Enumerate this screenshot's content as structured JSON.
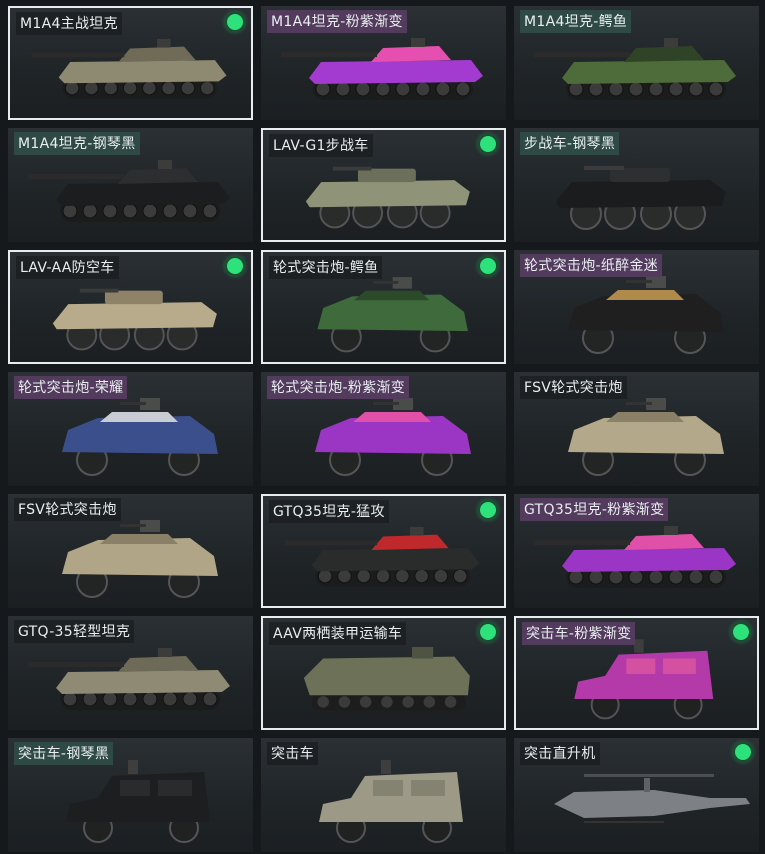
{
  "vehicles": [
    {
      "label": "M1A4主战坦克",
      "tag": "plain",
      "selected": true,
      "owned": true,
      "kind": "tank",
      "body": "#8e8a72",
      "accent": "#6f6b57"
    },
    {
      "label": "M1A4坦克-粉紫渐变",
      "tag": "purple",
      "selected": false,
      "owned": false,
      "kind": "tank",
      "body": "#a43bd0",
      "accent": "#e54fb0"
    },
    {
      "label": "M1A4坦克-鳄鱼",
      "tag": "teal",
      "selected": false,
      "owned": false,
      "kind": "tank",
      "body": "#4e6b3a",
      "accent": "#2f4426"
    },
    {
      "label": "M1A4坦克-钢琴黑",
      "tag": "teal",
      "selected": false,
      "owned": false,
      "kind": "tank",
      "body": "#1c1d1e",
      "accent": "#2d2e30"
    },
    {
      "label": "LAV-G1步战车",
      "tag": "plain",
      "selected": true,
      "owned": true,
      "kind": "apc",
      "body": "#8f9478",
      "accent": "#6c705a"
    },
    {
      "label": "步战车-钢琴黑",
      "tag": "teal",
      "selected": false,
      "owned": false,
      "kind": "apc",
      "body": "#1b1c1d",
      "accent": "#2e2f31"
    },
    {
      "label": "LAV-AA防空车",
      "tag": "plain",
      "selected": true,
      "owned": true,
      "kind": "apc",
      "body": "#b8ab8c",
      "accent": "#8e8368"
    },
    {
      "label": "轮式突击炮-鳄鱼",
      "tag": "plain",
      "selected": true,
      "owned": true,
      "kind": "armored",
      "body": "#3e6a3c",
      "accent": "#2a4a2a"
    },
    {
      "label": "轮式突击炮-纸醉金迷",
      "tag": "purple",
      "selected": false,
      "owned": false,
      "kind": "armored",
      "body": "#1f1f1f",
      "accent": "#b08a4a"
    },
    {
      "label": "轮式突击炮-荣耀",
      "tag": "purple",
      "selected": false,
      "owned": false,
      "kind": "armored",
      "body": "#3b4f8c",
      "accent": "#c9ccd2"
    },
    {
      "label": "轮式突击炮-粉紫渐变",
      "tag": "purple",
      "selected": false,
      "owned": false,
      "kind": "armored",
      "body": "#9b36c4",
      "accent": "#e04fa8"
    },
    {
      "label": "FSV轮式突击炮",
      "tag": "plain",
      "selected": false,
      "owned": false,
      "kind": "armored",
      "body": "#b3a88a",
      "accent": "#8a8067"
    },
    {
      "label": "FSV轮式突击炮",
      "tag": "plain",
      "selected": false,
      "owned": false,
      "kind": "armored",
      "body": "#b0a587",
      "accent": "#8a8067"
    },
    {
      "label": "GTQ35坦克-猛攻",
      "tag": "plain",
      "selected": true,
      "owned": true,
      "kind": "tank",
      "body": "#2a2c2c",
      "accent": "#c0292c"
    },
    {
      "label": "GTQ35坦克-粉紫渐变",
      "tag": "purple",
      "selected": false,
      "owned": false,
      "kind": "tank",
      "body": "#9a35c6",
      "accent": "#e04fa8"
    },
    {
      "label": "GTQ-35轻型坦克",
      "tag": "plain",
      "selected": false,
      "owned": false,
      "kind": "tank",
      "body": "#8f8a74",
      "accent": "#6e6a58"
    },
    {
      "label": "AAV两栖装甲运输车",
      "tag": "plain",
      "selected": true,
      "owned": true,
      "kind": "aav",
      "body": "#6c7158",
      "accent": "#4f5442"
    },
    {
      "label": "突击车-粉紫渐变",
      "tag": "purple",
      "selected": true,
      "owned": true,
      "kind": "truck",
      "body": "#b33aa8",
      "accent": "#e25a9c"
    },
    {
      "label": "突击车-钢琴黑",
      "tag": "teal",
      "selected": false,
      "owned": false,
      "kind": "truck",
      "body": "#1d1e1f",
      "accent": "#303133"
    },
    {
      "label": "突击车",
      "tag": "plain",
      "selected": false,
      "owned": false,
      "kind": "truck",
      "body": "#9c9a86",
      "accent": "#7a7866"
    },
    {
      "label": "突击直升机",
      "tag": "plain",
      "selected": false,
      "owned": true,
      "kind": "heli",
      "body": "#7d8186",
      "accent": "#5e6166"
    }
  ]
}
